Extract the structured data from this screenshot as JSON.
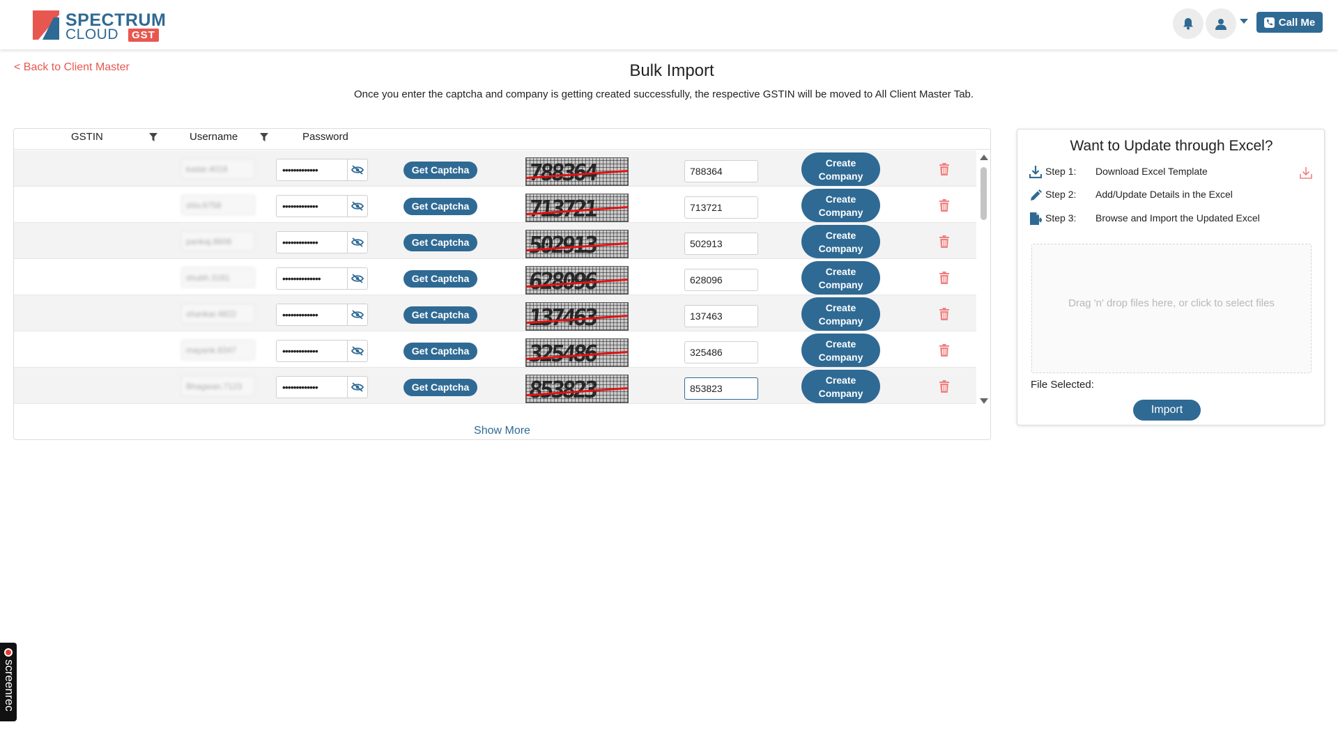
{
  "header": {
    "logo_word1": "SPECTRUM",
    "logo_word2": "CLOUD",
    "logo_gst": "GST",
    "call_me": "Call Me",
    "icons": [
      "bell-icon",
      "user-icon",
      "chevron-down-icon",
      "phone-icon"
    ]
  },
  "nav": {
    "back_link": "< Back to Client Master"
  },
  "page": {
    "title": "Bulk Import",
    "subtitle": "Once you enter the captcha and company is getting created successfully, the respective GSTIN will be moved to All Client Master Tab."
  },
  "table": {
    "headers": {
      "gstin": "GSTIN",
      "username": "Username",
      "password": "Password"
    },
    "get_captcha_label": "Get Captcha",
    "create_label_line1": "Create",
    "create_label_line2": "Company",
    "rows": [
      {
        "username": "kadar.4018",
        "password": "•••••••••••••",
        "captcha_image_text": "788364",
        "captcha_value": "788364"
      },
      {
        "username": "shiv.6758",
        "password": "•••••••••••••",
        "captcha_image_text": "713721",
        "captcha_value": "713721"
      },
      {
        "username": "pankaj.8606",
        "password": "•••••••••••••",
        "captcha_image_text": "502913",
        "captcha_value": "502913"
      },
      {
        "username": "shubh.3181",
        "password": "••••••••••••••",
        "captcha_image_text": "628096",
        "captcha_value": "628096"
      },
      {
        "username": "shankar.4822",
        "password": "•••••••••••••",
        "captcha_image_text": "137463",
        "captcha_value": "137463"
      },
      {
        "username": "mayank.8347",
        "password": "•••••••••••••",
        "captcha_image_text": "325486",
        "captcha_value": "325486"
      },
      {
        "username": "Bhagwan.7123",
        "password": "•••••••••••••",
        "captcha_image_text": "853823",
        "captcha_value": "853823"
      }
    ],
    "show_more": "Show More"
  },
  "excel": {
    "title": "Want to Update through Excel?",
    "steps": [
      {
        "label": "Step 1:",
        "text": "Download Excel Template",
        "icon": "download-icon"
      },
      {
        "label": "Step 2:",
        "text": "Add/Update Details in the Excel",
        "icon": "pencil-icon"
      },
      {
        "label": "Step 3:",
        "text": "Browse and Import the Updated Excel",
        "icon": "file-import-icon"
      }
    ],
    "dropzone_text": "Drag 'n' drop files here, or click to select files",
    "file_selected": "File Selected:",
    "import_label": "Import"
  },
  "recorder": {
    "label": "screenrec"
  },
  "colors": {
    "primary": "#2f6a94",
    "accent": "#e8574f",
    "trash": "#f08080"
  }
}
